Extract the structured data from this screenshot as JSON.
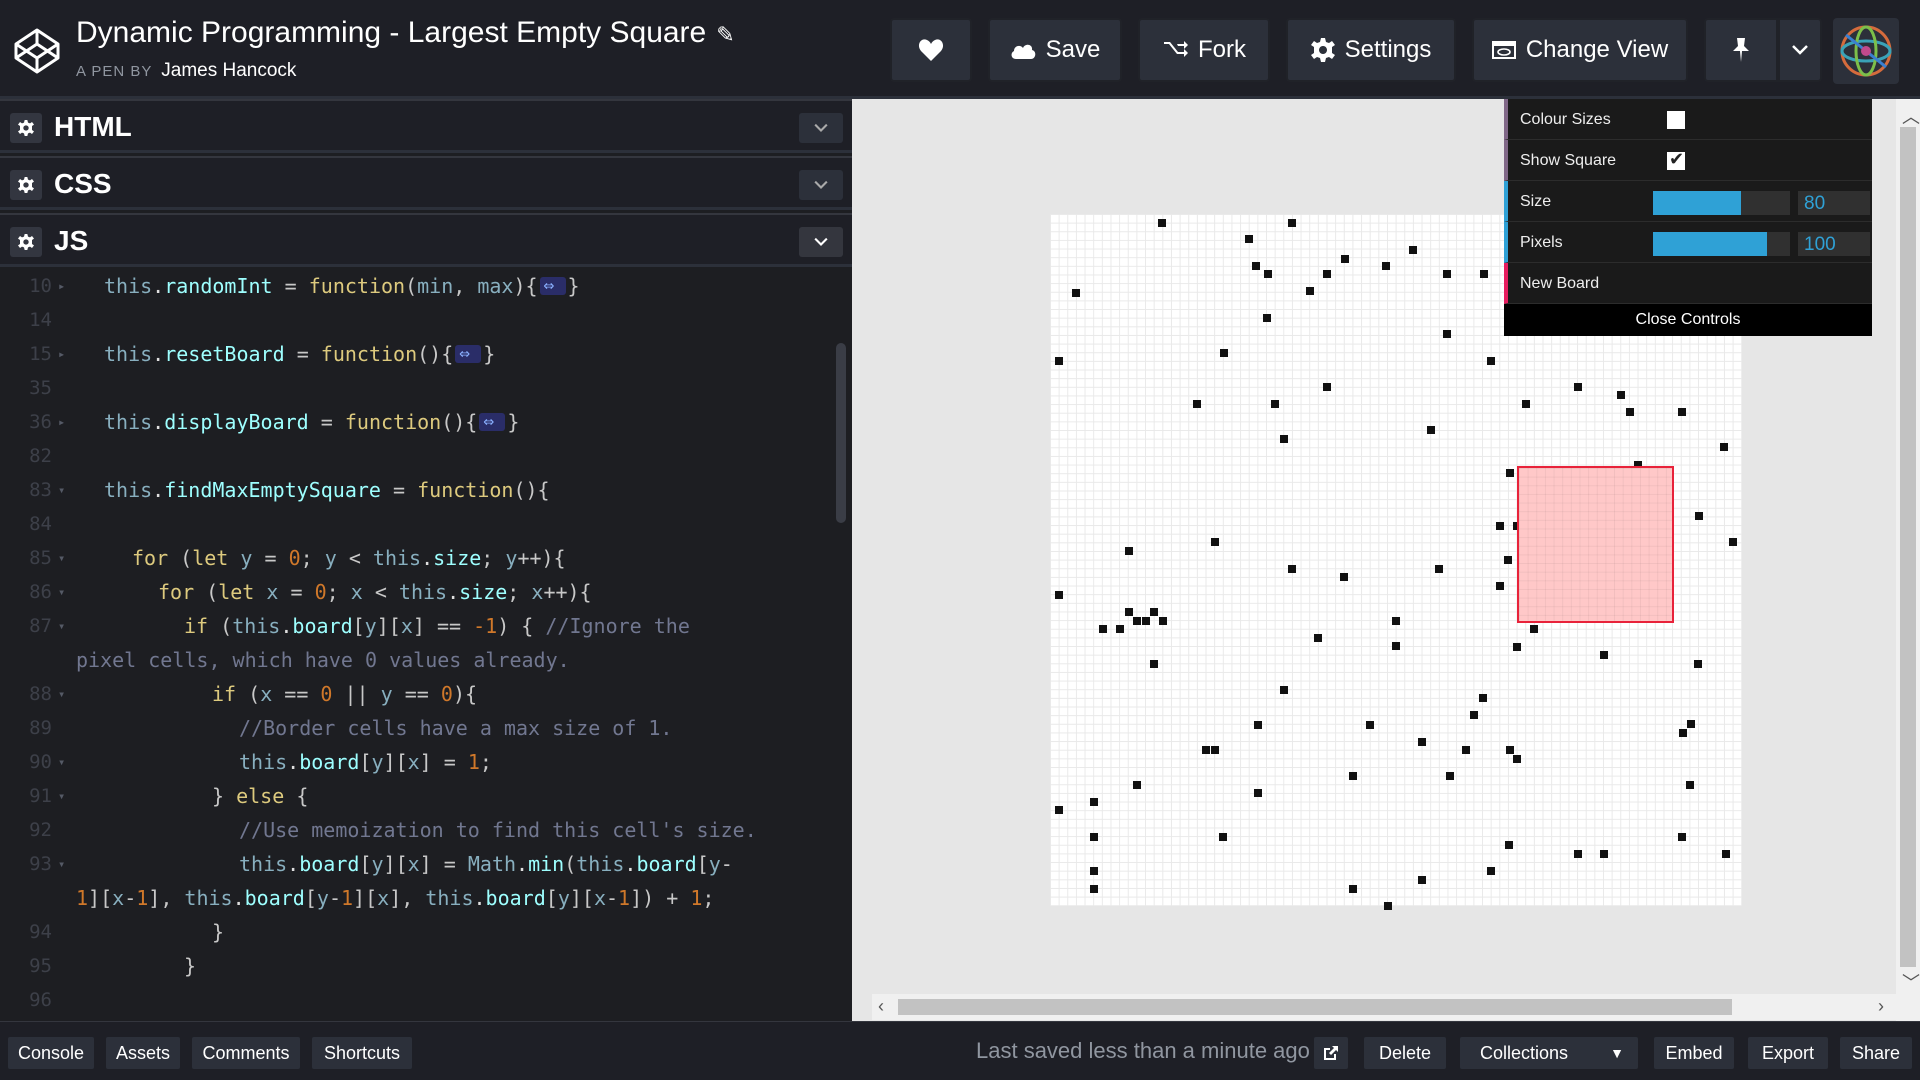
{
  "header": {
    "title": "Dynamic Programming - Largest Empty Square",
    "byline_prefix": "A PEN BY",
    "author": "James Hancock",
    "buttons": {
      "save": "Save",
      "fork": "Fork",
      "settings": "Settings",
      "change_view": "Change View"
    }
  },
  "panels": {
    "html": "HTML",
    "css": "CSS",
    "js": "JS"
  },
  "code": {
    "lines": [
      {
        "n": "10",
        "fold": true,
        "html": "<span class='v'>this</span>.<span class='p'>randomInt</span> <span class='pu'>=</span> <span class='k'>function</span><span class='pu'>(</span><span class='v'>min</span><span class='pu'>,</span> <span class='v'>max</span><span class='pu'>)</span> <span class='pu'>{</span><span class='fold'></span><span class='pu'>}</span>"
      },
      {
        "n": "14",
        "html": ""
      },
      {
        "n": "15",
        "fold": true,
        "html": "<span class='v'>this</span>.<span class='p'>resetBoard</span> <span class='pu'>=</span> <span class='k'>function</span><span class='pu'>()</span> <span class='pu'>{</span><span class='fold'></span><span class='pu'>}</span>"
      }
    ]
  },
  "gui": {
    "colour_sizes": "Colour Sizes",
    "show_square": "Show Square",
    "size_label": "Size",
    "size_value": "80",
    "size_fraction": 0.64,
    "pixels_label": "Pixels",
    "pixels_value": "100",
    "pixels_fraction": 0.83,
    "new_board": "New Board",
    "close_controls": "Close Controls"
  },
  "footer": {
    "console": "Console",
    "assets": "Assets",
    "comments": "Comments",
    "shortcuts": "Shortcuts",
    "saved_status": "Last saved less than a minute ago",
    "delete": "Delete",
    "collections": "Collections",
    "embed": "Embed",
    "export": "Export",
    "share": "Share"
  }
}
